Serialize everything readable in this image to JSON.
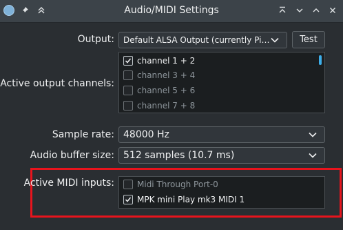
{
  "window": {
    "title": "Audio/MIDI Settings",
    "left_icons": [
      "app-icon",
      "pin-icon",
      "keep-above-icon"
    ],
    "right_icons": [
      "keep-on-top-icon",
      "minimize-icon",
      "maximize-icon",
      "close-icon"
    ]
  },
  "output": {
    "label": "Output:",
    "value": "Default ALSA Output (currently PipeWire M...",
    "test_label": "Test"
  },
  "output_channels": {
    "label": "Active output channels:",
    "items": [
      {
        "label": "channel 1 + 2",
        "checked": true
      },
      {
        "label": "channel 3 + 4",
        "checked": false
      },
      {
        "label": "channel 5 + 6",
        "checked": false
      },
      {
        "label": "channel 7 + 8",
        "checked": false
      }
    ]
  },
  "sample_rate": {
    "label": "Sample rate:",
    "value": "48000 Hz"
  },
  "buffer_size": {
    "label": "Audio buffer size:",
    "value": "512 samples (10.7 ms)"
  },
  "midi_inputs": {
    "label": "Active MIDI inputs:",
    "items": [
      {
        "label": "Midi Through Port-0",
        "checked": false
      },
      {
        "label": "MPK mini Play mk3 MIDI 1",
        "checked": true
      }
    ]
  },
  "colors": {
    "highlight": "#e8141d",
    "accent": "#3daee9"
  }
}
